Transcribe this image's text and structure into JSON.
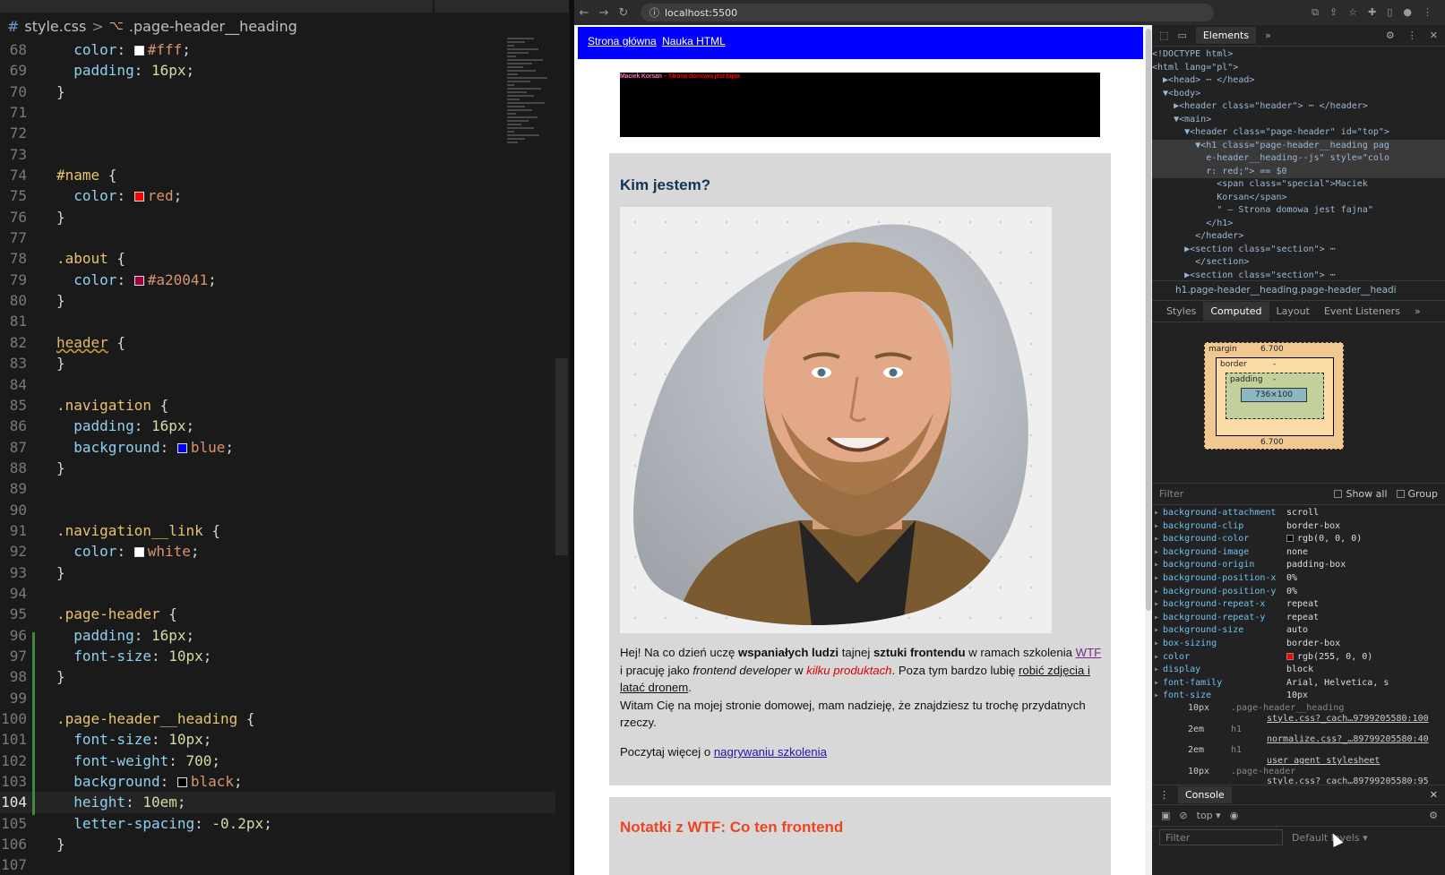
{
  "editor": {
    "breadcrumb": {
      "file": "style.css",
      "separator": ">",
      "symbol": ".page-header__heading",
      "file_icon": "hash-icon",
      "symbol_icon": "symbol-class-icon"
    },
    "lines": [
      {
        "n": "68",
        "text": "  color: #fff;"
      },
      {
        "n": "69",
        "text": "  padding: 16px;"
      },
      {
        "n": "70",
        "text": "}"
      },
      {
        "n": "71",
        "text": ""
      },
      {
        "n": "72",
        "text": ""
      },
      {
        "n": "73",
        "text": ""
      },
      {
        "n": "74",
        "text": "#name {"
      },
      {
        "n": "75",
        "text": "  color: red;"
      },
      {
        "n": "76",
        "text": "}"
      },
      {
        "n": "77",
        "text": ""
      },
      {
        "n": "78",
        "text": ".about {"
      },
      {
        "n": "79",
        "text": "  color: #a20041;"
      },
      {
        "n": "80",
        "text": "}"
      },
      {
        "n": "81",
        "text": ""
      },
      {
        "n": "82",
        "text": "header {"
      },
      {
        "n": "83",
        "text": "}"
      },
      {
        "n": "84",
        "text": ""
      },
      {
        "n": "85",
        "text": ".navigation {"
      },
      {
        "n": "86",
        "text": "  padding: 16px;"
      },
      {
        "n": "87",
        "text": "  background: blue;"
      },
      {
        "n": "88",
        "text": "}"
      },
      {
        "n": "89",
        "text": ""
      },
      {
        "n": "90",
        "text": ""
      },
      {
        "n": "91",
        "text": ".navigation__link {"
      },
      {
        "n": "92",
        "text": "  color: white;"
      },
      {
        "n": "93",
        "text": "}"
      },
      {
        "n": "94",
        "text": ""
      },
      {
        "n": "95",
        "text": ".page-header {"
      },
      {
        "n": "96",
        "text": "  padding: 16px;"
      },
      {
        "n": "97",
        "text": "  font-size: 10px;"
      },
      {
        "n": "98",
        "text": "}"
      },
      {
        "n": "99",
        "text": ""
      },
      {
        "n": "100",
        "text": ".page-header__heading {"
      },
      {
        "n": "101",
        "text": "  font-size: 10px;"
      },
      {
        "n": "102",
        "text": "  font-weight: 700;"
      },
      {
        "n": "103",
        "text": "  background: black;"
      },
      {
        "n": "104",
        "text": "  height: 10em;"
      },
      {
        "n": "105",
        "text": "  letter-spacing: -0.2px;"
      },
      {
        "n": "106",
        "text": "}"
      },
      {
        "n": "107",
        "text": ""
      }
    ],
    "current_line": "104",
    "colors": {
      "fff": "#ffffff",
      "red": "#ff0000",
      "a20041": "#a20041",
      "blue": "#0000ff",
      "white": "#ffffff",
      "black": "#000000"
    }
  },
  "browser": {
    "url": "localhost:5500",
    "nav_icons": [
      "back-icon",
      "forward-icon",
      "reload-icon"
    ],
    "page": {
      "nav_links": [
        "Strona główna",
        "Nauka HTML"
      ],
      "header_special": "Maciek Korsan",
      "header_rest": " – Strona domowa jest fajna",
      "section_title": "Kim jestem?",
      "bio": {
        "p1a": "Hej! Na co dzień uczę ",
        "p1b": "wspaniałych ludzi",
        "p1c": " tajnej ",
        "p1d": "sztuki frontendu",
        "p1e": " w ramach szkolenia ",
        "p1f": "WTF",
        "p1g": " i pracuję jako ",
        "p1h": "frontend developer",
        "p1i": " w ",
        "p1j": "kilku produktach",
        "p1k": ". Poza tym bardzo lubię ",
        "p1l": "robić zdjęcia i latać dronem",
        "p1m": ".",
        "p2": "Witam Cię na mojej stronie domowej, mam nadzieję, że znajdziesz tu trochę przydatnych rzeczy."
      },
      "more_prefix": "Poczytaj więcej o ",
      "more_link": "nagrywaniu szkolenia",
      "section2_title": "Notatki z WTF: Co ten frontend"
    }
  },
  "devtools": {
    "toolbar": {
      "active_tab": "Elements",
      "more": "»"
    },
    "dom": [
      "<!DOCTYPE html>",
      "<html lang=\"pl\">",
      "  ▶<head> ⋯ </head>",
      "  ▼<body>",
      "    ▶<header class=\"header\"> ⋯ </header>",
      "    ▼<main>",
      "      ▼<header class=\"page-header\" id=\"top\">",
      "        ▼<h1 class=\"page-header__heading pag",
      "          e-header__heading--js\" style=\"colo",
      "          r: red;\"> == $0",
      "            <span class=\"special\">Maciek",
      "            Korsan</span>",
      "            \" – Strona domowa jest fajna\"",
      "          </h1>",
      "        </header>",
      "      ▶<section class=\"section\"> ⋯",
      "        </section>",
      "      ▶<section class=\"section\"> ⋯"
    ],
    "crumb": "h1.page-header__heading.page-header__headi",
    "tabs": [
      "Styles",
      "Computed",
      "Layout",
      "Event Listeners",
      "»"
    ],
    "active_tab": "Computed",
    "box_model": {
      "margin_label": "margin",
      "margin_top": "6.700",
      "margin_bottom": "6.700",
      "border_label": "border",
      "border_val": "-",
      "padding_label": "padding",
      "padding_val": "-",
      "content": "736×100",
      "dash": "-"
    },
    "filter_placeholder": "Filter",
    "show_all": "Show all",
    "group": "Group",
    "props": [
      {
        "name": "background-attachment",
        "value": "scroll"
      },
      {
        "name": "background-clip",
        "value": "border-box"
      },
      {
        "name": "background-color",
        "value": "rgb(0, 0, 0)",
        "swatch": "#000000"
      },
      {
        "name": "background-image",
        "value": "none"
      },
      {
        "name": "background-origin",
        "value": "padding-box"
      },
      {
        "name": "background-position-x",
        "value": "0%"
      },
      {
        "name": "background-position-y",
        "value": "0%"
      },
      {
        "name": "background-repeat-x",
        "value": "repeat"
      },
      {
        "name": "background-repeat-y",
        "value": "repeat"
      },
      {
        "name": "background-size",
        "value": "auto"
      },
      {
        "name": "box-sizing",
        "value": "border-box"
      },
      {
        "name": "color",
        "value": "rgb(255, 0, 0)",
        "swatch": "#ff0000"
      },
      {
        "name": "display",
        "value": "block"
      },
      {
        "name": "font-family",
        "value": "Arial, Helvetica, s"
      },
      {
        "name": "font-size",
        "value": "10px"
      }
    ],
    "traces": [
      {
        "val": "10px",
        "sel": ".page-header__heading",
        "link": "style.css?_cach…9799205580:100"
      },
      {
        "val": "2em",
        "sel": "h1",
        "link": "normalize.css?_…89799205580:40"
      },
      {
        "val": "2em",
        "sel": "h1",
        "link": "user agent stylesheet"
      },
      {
        "val": "10px",
        "sel": ".page-header",
        "link": "style.css?_cach…89799205580:95"
      }
    ],
    "console": {
      "tab": "Console",
      "context": "top",
      "filter_placeholder": "Filter",
      "levels": "Default levels ▾"
    }
  }
}
